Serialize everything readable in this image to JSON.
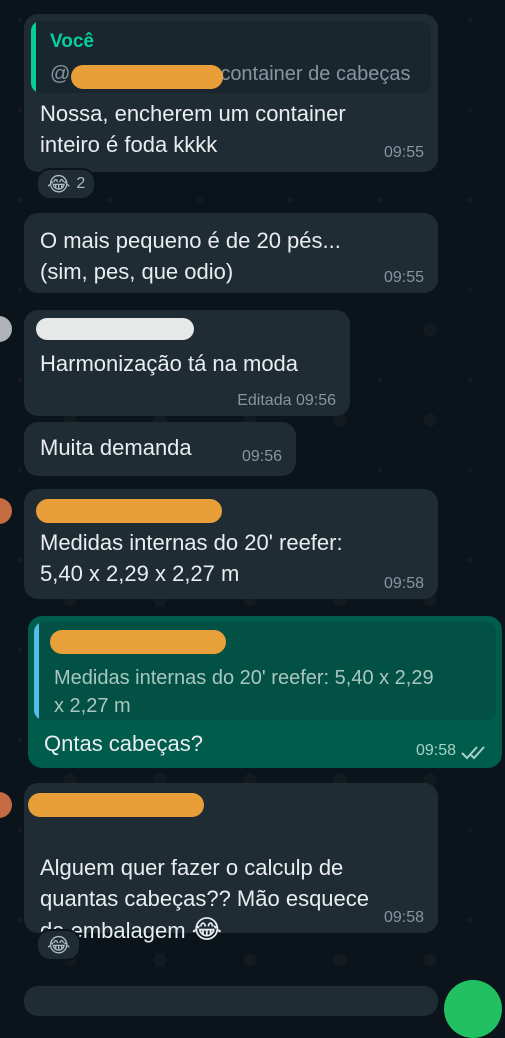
{
  "messages": {
    "m1": {
      "quote_sender": "Você",
      "quote_prefix": "@",
      "quote_text": "container de cabeças",
      "text": "Nossa, encherem um container\ninteiro é foda kkkk",
      "time": "09:55",
      "reaction_emoji": "😂",
      "reaction_count": "2"
    },
    "m2": {
      "text": "O mais pequeno é de 20 pés...\n(sim, pes, que odio)",
      "time": "09:55"
    },
    "m3": {
      "text": "Harmonização tá na moda",
      "edited": "Editada",
      "time": "09:56"
    },
    "m4": {
      "text": "Muita demanda",
      "time": "09:56"
    },
    "m5": {
      "text": "Medidas internas do 20' reefer:\n5,40 x 2,29 x 2,27 m",
      "time": "09:58"
    },
    "m6": {
      "quote_text": "Medidas internas do 20' reefer: 5,40 x 2,29\nx 2,27 m",
      "text": "Qntas cabeças?",
      "time": "09:58",
      "status": "read"
    },
    "m7": {
      "text": "Alguem quer fazer o calculp de\nquantas cabeças?? Mão esquece\nda embalagem",
      "emoji": "😂",
      "time": "09:58",
      "reaction_emoji": "😂"
    }
  },
  "colors": {
    "incoming_bubble": "#1f2c34",
    "outgoing_bubble": "#005c4b",
    "quote_bar_self": "#06cf9c",
    "quote_bar_other": "#53bdeb",
    "read_ticks": "#a6d2c8",
    "redaction": "#f4a53a"
  },
  "icons": [
    "laughing-emoji-icon",
    "read-receipt-icon",
    "fab-icon"
  ]
}
